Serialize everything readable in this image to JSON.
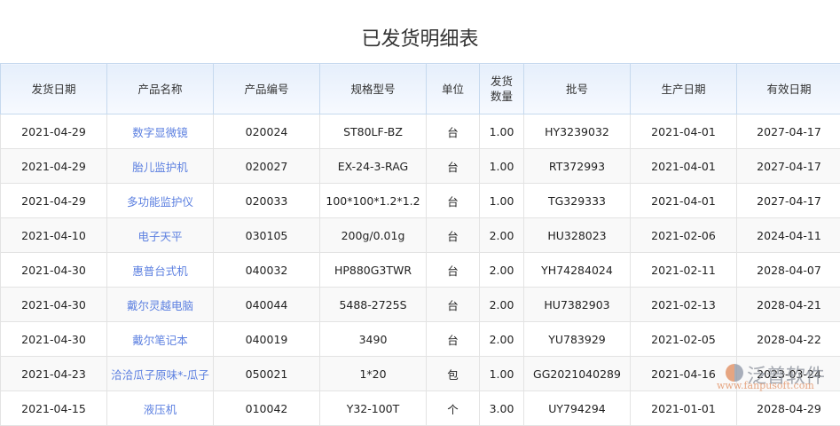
{
  "title": "已发货明细表",
  "columns": [
    "发货日期",
    "产品名称",
    "产品编号",
    "规格型号",
    "单位",
    "发货\n数量",
    "批号",
    "生产日期",
    "有效日期"
  ],
  "rows": [
    [
      "2021-04-29",
      "数字显微镜",
      "020024",
      "ST80LF-BZ",
      "台",
      "1.00",
      "HY3239032",
      "2021-04-01",
      "2027-04-17"
    ],
    [
      "2021-04-29",
      "胎儿监护机",
      "020027",
      "EX-24-3-RAG",
      "台",
      "1.00",
      "RT372993",
      "2021-04-01",
      "2027-04-17"
    ],
    [
      "2021-04-29",
      "多功能监护仪",
      "020033",
      "100*100*1.2*1.2",
      "台",
      "1.00",
      "TG329333",
      "2021-04-01",
      "2027-04-17"
    ],
    [
      "2021-04-10",
      "电子天平",
      "030105",
      "200g/0.01g",
      "台",
      "2.00",
      "HU328023",
      "2021-02-06",
      "2024-04-11"
    ],
    [
      "2021-04-30",
      "惠普台式机",
      "040032",
      "HP880G3TWR",
      "台",
      "2.00",
      "YH74284024",
      "2021-02-11",
      "2028-04-07"
    ],
    [
      "2021-04-30",
      "戴尔灵越电脑",
      "040044",
      "5488-2725S",
      "台",
      "2.00",
      "HU7382903",
      "2021-02-13",
      "2028-04-21"
    ],
    [
      "2021-04-30",
      "戴尔笔记本",
      "040019",
      "3490",
      "台",
      "2.00",
      "YU783929",
      "2021-02-05",
      "2028-04-22"
    ],
    [
      "2021-04-23",
      "洽洽瓜子原味*-瓜子",
      "050021",
      "1*20",
      "包",
      "1.00",
      "GG2021040289",
      "2021-04-16",
      "2023-03-24"
    ],
    [
      "2021-04-15",
      "液压机",
      "010042",
      "Y32-100T",
      "个",
      "3.00",
      "UY794294",
      "2021-01-01",
      "2028-04-29"
    ]
  ],
  "watermark": {
    "name": "泛普软件",
    "url": "www.fanpusoft.com"
  },
  "colors": {
    "link": "#5b7fe0",
    "header_bg": "#e6effb"
  }
}
